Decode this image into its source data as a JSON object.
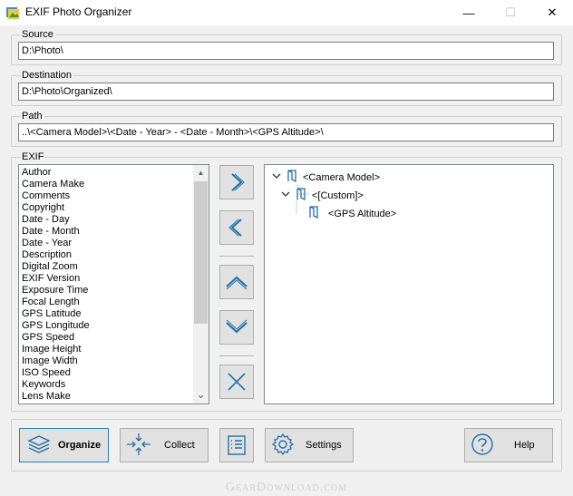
{
  "window": {
    "title": "EXIF Photo Organizer",
    "minimize_glyph": "—",
    "maximize_glyph": "☐",
    "close_glyph": "✕"
  },
  "source": {
    "label": "Source",
    "value": "D:\\Photo\\"
  },
  "destination": {
    "label": "Destination",
    "value": "D:\\Photo\\Organized\\"
  },
  "path": {
    "label": "Path",
    "value": "..\\<Camera Model>\\<Date - Year> - <Date - Month>\\<GPS Altitude>\\"
  },
  "exif": {
    "label": "EXIF",
    "items": [
      "Author",
      "Camera Make",
      "Comments",
      "Copyright",
      "Date - Day",
      "Date - Month",
      "Date - Year",
      "Description",
      "Digital Zoom",
      "EXIF Version",
      "Exposure Time",
      "Focal Length",
      "GPS Latitude",
      "GPS Longitude",
      "GPS Speed",
      "Image Height",
      "Image Width",
      "ISO Speed",
      "Keywords",
      "Lens Make"
    ],
    "scroll_up_glyph": "▲",
    "scroll_down_glyph": "⌄"
  },
  "tree": {
    "nodes": [
      "<Camera Model>",
      "<[Custom]>",
      "<GPS Altitude>"
    ]
  },
  "buttons": {
    "organize": "Organize",
    "collect": "Collect",
    "settings": "Settings",
    "help": "Help"
  },
  "icons": {
    "add": "chevron-right-icon",
    "remove": "chevron-left-icon",
    "up": "chevron-up-icon",
    "down": "chevron-down-icon",
    "delete": "x-icon"
  },
  "colors": {
    "accent": "#2f7db8",
    "icon": "#1f6fa8"
  },
  "watermark": "GearDownload.com"
}
